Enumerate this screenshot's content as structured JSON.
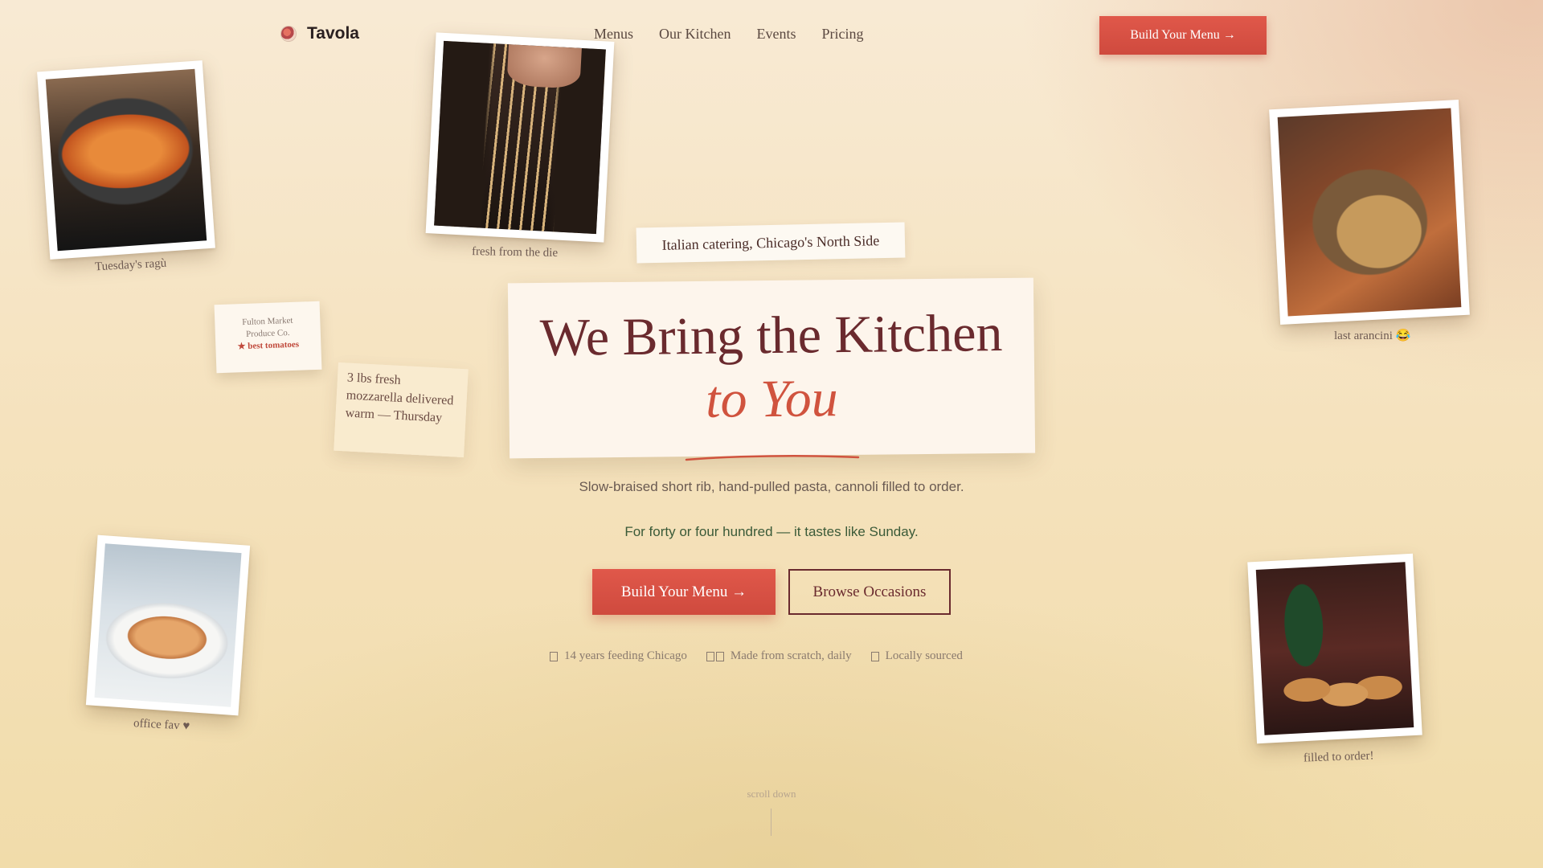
{
  "nav": {
    "brand": "Tavola",
    "links": [
      "Menus",
      "Our Kitchen",
      "Events",
      "Pricing"
    ],
    "cta": "Build Your Menu →"
  },
  "photos": [
    {
      "name": "ragu",
      "caption": "Tuesday's ragù"
    },
    {
      "name": "pasta",
      "caption": "fresh from the die"
    },
    {
      "name": "arancini",
      "caption": "last arancini 😂"
    },
    {
      "name": "lasagna",
      "caption": "office fav ♥"
    },
    {
      "name": "cannoli",
      "caption": "filled to order!"
    }
  ],
  "notes": {
    "fulton_line1": "Fulton Market",
    "fulton_line2": "Produce Co.",
    "fulton_line3": "★ best tomatoes",
    "mozzarella": "3 lbs fresh mozzarella delivered warm — Thursday"
  },
  "hero": {
    "tagline": "Italian catering, Chicago's North Side",
    "title_line1": "We Bring the Kitchen",
    "title_line2": "to You",
    "subtitle": "Slow-braised short rib, hand-pulled pasta, cannoli filled to order.",
    "subtitle2": "For forty or four hundred — it tastes like Sunday.",
    "primary_cta": "Build Your Menu →",
    "secondary_cta": "Browse Occasions"
  },
  "badges": [
    "14 years feeding Chicago",
    "Made from scratch, daily",
    "Locally sourced"
  ],
  "scroll_hint": "scroll down",
  "colors": {
    "accent": "#d9503f",
    "wine": "#6a2a2e",
    "green": "#3a5a38"
  }
}
